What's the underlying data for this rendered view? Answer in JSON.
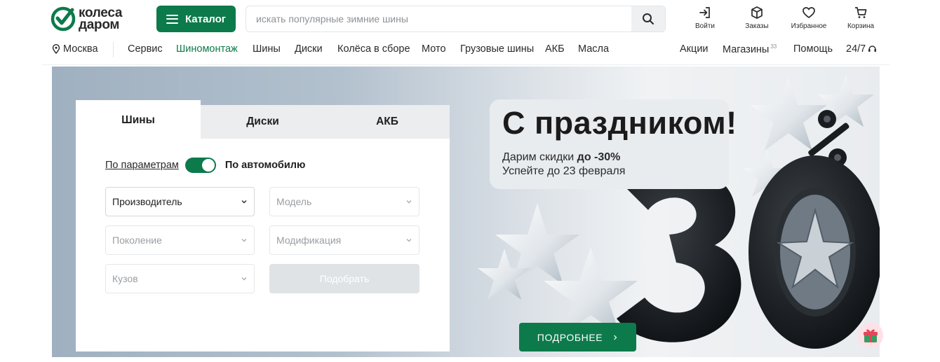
{
  "brand": {
    "name_line1": "колеса",
    "name_line2": "даром",
    "accent_color": "#0d7a4b",
    "logo_icon": "checkmark-circle-icon"
  },
  "header": {
    "catalog_label": "Каталог",
    "search_placeholder": "искать популярные зимние шины",
    "actions": [
      {
        "label": "Войти",
        "icon": "login-icon"
      },
      {
        "label": "Заказы",
        "icon": "box-icon"
      },
      {
        "label": "Избранное",
        "icon": "heart-icon"
      },
      {
        "label": "Корзина",
        "icon": "cart-icon"
      }
    ]
  },
  "nav": {
    "city": "Москва",
    "items": [
      {
        "label": "Сервис"
      },
      {
        "label": "Шиномонтаж",
        "active": true
      },
      {
        "label": "Шины"
      },
      {
        "label": "Диски"
      },
      {
        "label": "Колёса в сборе"
      },
      {
        "label": "Мото"
      },
      {
        "label": "Грузовые шины"
      },
      {
        "label": "АКБ"
      },
      {
        "label": "Масла"
      }
    ],
    "right": {
      "promo": "Акции",
      "stores": "Магазины",
      "stores_count": "33",
      "help": "Помощь",
      "support": "24/7"
    }
  },
  "picker": {
    "tabs": [
      "Шины",
      "Диски",
      "АКБ"
    ],
    "active_tab": "Шины",
    "mode_link": "По параметрам",
    "mode_active": "По автомобилю",
    "fields": {
      "manufacturer": "Производитель",
      "model": "Модель",
      "generation": "Поколение",
      "modification": "Модификация",
      "body": "Кузов"
    },
    "submit_label": "Подобрать"
  },
  "promo": {
    "title": "С праздником!",
    "line1_prefix": "Дарим скидки ",
    "line1_bold": "до -30%",
    "line2": "Успейте до 23 февраля",
    "big_number": "30",
    "more_label": "ПОДРОБНЕЕ"
  }
}
